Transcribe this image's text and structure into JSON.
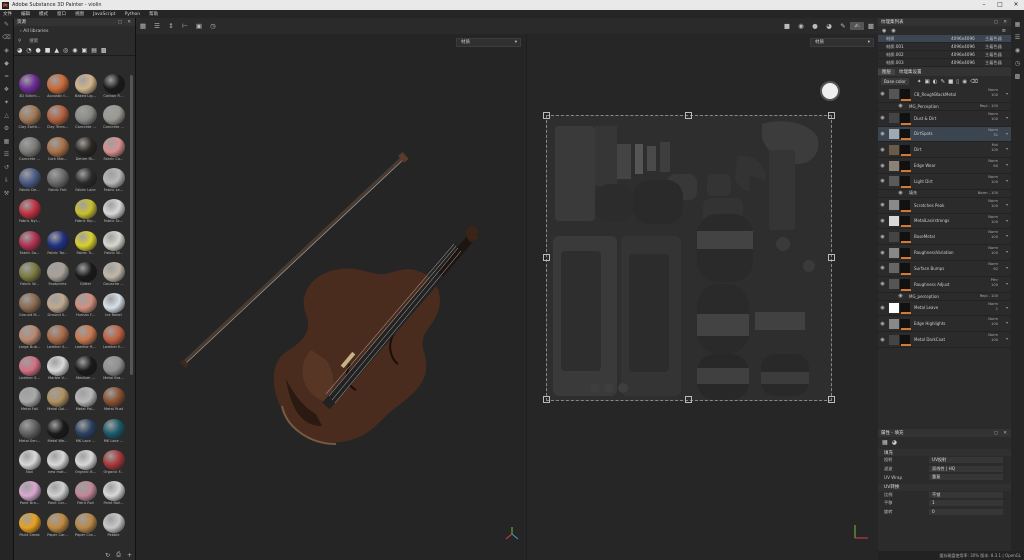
{
  "window": {
    "title": "Adobe Substance 3D Painter - violin",
    "app_icon": "Pt"
  },
  "menu": [
    "文件",
    "编辑",
    "模式",
    "窗口",
    "视图",
    "JavaScript",
    "Python",
    "帮助"
  ],
  "shelf": {
    "title": "资源",
    "library": "All libraries",
    "search_label": "搜索",
    "materials": [
      {
        "label": "3D Stitchi...",
        "color": "#6b2a94"
      },
      {
        "label": "Acoustic f...",
        "color": "#c86a3a"
      },
      {
        "label": "Baked Lig...",
        "color": "#d0b48a"
      },
      {
        "label": "Carbon Fi...",
        "color": "#1a1a1a"
      },
      {
        "label": "Clay Earth...",
        "color": "#a07856"
      },
      {
        "label": "Clay Terra...",
        "color": "#b2603e"
      },
      {
        "label": "Concrete ...",
        "color": "#8a8a86"
      },
      {
        "label": "Concrete ...",
        "color": "#9a9892"
      },
      {
        "label": "Concrete ...",
        "color": "#7a7a76"
      },
      {
        "label": "Cork Mat...",
        "color": "#a87048"
      },
      {
        "label": "Denim Ri...",
        "color": "#2a2622"
      },
      {
        "label": "Fabric Co...",
        "color": "#d89090"
      },
      {
        "label": "Fabric De...",
        "color": "#4a5a86"
      },
      {
        "label": "Fabric Felt",
        "color": "#6a6a6a"
      },
      {
        "label": "Fabric Lace",
        "color": "#2a2a2a"
      },
      {
        "label": "Fabric Le...",
        "color": "#b8b8b8"
      },
      {
        "label": "Fabric Nyl...",
        "color": "#c03040"
      },
      {
        "label": "",
        "color": "#2b2b2b"
      },
      {
        "label": "Fabric Rip...",
        "color": "#c8c030"
      },
      {
        "label": "Fabric Sc...",
        "color": "#d8d8d8"
      },
      {
        "label": "Fabric Sa...",
        "color": "#b03050"
      },
      {
        "label": "Fabric Tar...",
        "color": "#203080"
      },
      {
        "label": "Fabric Tr...",
        "color": "#d8d030"
      },
      {
        "label": "Fabric W...",
        "color": "#d8d8d0"
      },
      {
        "label": "Fabric W...",
        "color": "#7a7a40"
      },
      {
        "label": "Footprints",
        "color": "#a8a098"
      },
      {
        "label": "Glitter",
        "color": "#1a1a1a"
      },
      {
        "label": "Gouache ...",
        "color": "#c0b8a8"
      },
      {
        "label": "Ground M...",
        "color": "#8a6a50"
      },
      {
        "label": "Ground S...",
        "color": "#c0a890"
      },
      {
        "label": "Human F...",
        "color": "#d09080"
      },
      {
        "label": "Ice Rebel",
        "color": "#d8e0e8"
      },
      {
        "label": "Large Bub...",
        "color": "#b88870"
      },
      {
        "label": "Leather S...",
        "color": "#a86a48"
      },
      {
        "label": "Leather R...",
        "color": "#c87850"
      },
      {
        "label": "Leather E...",
        "color": "#c06040"
      },
      {
        "label": "Leather S...",
        "color": "#d07080"
      },
      {
        "label": "Marble V...",
        "color": "#d8d8d8"
      },
      {
        "label": "Medium ...",
        "color": "#1a1a1a"
      },
      {
        "label": "Metal Bra...",
        "color": "#909090"
      },
      {
        "label": "Metal Foil",
        "color": "#a8a8a8"
      },
      {
        "label": "Metal Gol...",
        "color": "#b09060"
      },
      {
        "label": "Metal Pol...",
        "color": "#b8b8b8"
      },
      {
        "label": "Metal Rust",
        "color": "#8a5030"
      },
      {
        "label": "Metal Sen...",
        "color": "#606060"
      },
      {
        "label": "Metal We...",
        "color": "#1a1a1a"
      },
      {
        "label": "MK Lace ...",
        "color": "#2a4060"
      },
      {
        "label": "MK Lace ...",
        "color": "#1a5a6a"
      },
      {
        "label": "Noil",
        "color": "#d8d8d8"
      },
      {
        "label": "new mat...",
        "color": "#d8d8d8"
      },
      {
        "label": "Organic B...",
        "color": "#d8d8d8"
      },
      {
        "label": "Organic F...",
        "color": "#a83838"
      },
      {
        "label": "Paint Bra...",
        "color": "#d8a8d0"
      },
      {
        "label": "Paint Car...",
        "color": "#d0d0d0"
      },
      {
        "label": "Paint Roll",
        "color": "#c08898"
      },
      {
        "label": "Paint Roll...",
        "color": "#d8d8d8"
      },
      {
        "label": "Paint Smea",
        "color": "#e8a020"
      },
      {
        "label": "Paper Car...",
        "color": "#c08a40"
      },
      {
        "label": "Paper Cra...",
        "color": "#b88848"
      },
      {
        "label": "Pebble",
        "color": "#c8c8c8"
      }
    ]
  },
  "viewport": {
    "left_dropdown": "材质",
    "right_dropdown": "材质"
  },
  "texture_sets": {
    "title": "纹理集列表",
    "rows": [
      {
        "name": "材质",
        "res": "4096x4096",
        "shader": "主着色器"
      },
      {
        "name": "材质.001",
        "res": "4096x4096",
        "shader": "主着色器"
      },
      {
        "name": "材质.002",
        "res": "4096x4096",
        "shader": "主着色器"
      },
      {
        "name": "材质.003",
        "res": "4096x4096",
        "shader": "主着色器"
      }
    ]
  },
  "layers": {
    "tabs": [
      "图层",
      "纹理集设置"
    ],
    "blend_mode": "Base color",
    "items": [
      {
        "name": "CB_RoughBlackMetal",
        "blend": "Norm",
        "opacity": "100",
        "thumb": "#555555",
        "type": "layer",
        "sel": false
      },
      {
        "name": "MG_Perception",
        "blend": "Repl",
        "opacity": "100",
        "thumb": "#444444",
        "type": "sub",
        "sel": false
      },
      {
        "name": "Dust & Dirt",
        "blend": "Norm",
        "opacity": "100",
        "thumb": "#444444",
        "type": "layer",
        "sel": false
      },
      {
        "name": "DirtSpots",
        "blend": "Norm",
        "opacity": "31",
        "thumb": "#a0a8b0",
        "type": "layer",
        "sel": true
      },
      {
        "name": "Dirt",
        "blend": "Mul",
        "opacity": "100",
        "thumb": "#6a5a48",
        "type": "layer",
        "sel": false
      },
      {
        "name": "Edge Wear",
        "blend": "Norm",
        "opacity": "60",
        "thumb": "#8a8278",
        "type": "layer",
        "sel": false
      },
      {
        "name": "Light Dirt",
        "blend": "Norm",
        "opacity": "100",
        "thumb": "#5a5a5a",
        "type": "layer",
        "sel": false
      },
      {
        "name": "填充",
        "blend": "Norm",
        "opacity": "100",
        "thumb": "#444444",
        "type": "sub",
        "sel": false
      },
      {
        "name": "Scratches Peak",
        "blend": "Norm",
        "opacity": "100",
        "thumb": "#8a8a8a",
        "type": "layer",
        "sel": false
      },
      {
        "name": "MetalLasirstrongs",
        "blend": "Norm",
        "opacity": "100",
        "thumb": "#d8d8d8",
        "type": "layer",
        "sel": false
      },
      {
        "name": "BaseMetal",
        "blend": "Norm",
        "opacity": "100",
        "thumb": "#444444",
        "type": "layer",
        "sel": false
      },
      {
        "name": "RoughnessVariation",
        "blend": "Norm",
        "opacity": "100",
        "thumb": "#888888",
        "type": "layer",
        "sel": false
      },
      {
        "name": "Surface Bumps",
        "blend": "Norm",
        "opacity": "62",
        "thumb": "#666666",
        "type": "layer",
        "sel": false
      },
      {
        "name": "Roughness Adjust",
        "blend": "Pthr",
        "opacity": "100",
        "thumb": "#555555",
        "type": "layer",
        "sel": false
      },
      {
        "name": "MG_perception",
        "blend": "Repl",
        "opacity": "100",
        "thumb": "#444444",
        "type": "sub",
        "sel": false
      },
      {
        "name": "Metal Leave",
        "blend": "Norm",
        "opacity": "1",
        "thumb": "#ffffff",
        "type": "layer",
        "sel": false
      },
      {
        "name": "Edge Highlights",
        "blend": "Norm",
        "opacity": "100",
        "thumb": "#888888",
        "type": "layer",
        "sel": false
      },
      {
        "name": "Metal DarkCoat",
        "blend": "Norm",
        "opacity": "100",
        "thumb": "#444444",
        "type": "layer",
        "sel": false
      }
    ]
  },
  "properties": {
    "title": "属性 - 填充",
    "section": "填充",
    "rows": [
      {
        "label": "投射",
        "value": "UV投射"
      },
      {
        "label": "滤波",
        "value": "双线性 | HQ"
      },
      {
        "label": "UV Wrap",
        "value": "重复"
      }
    ],
    "uv_section": "UV转换",
    "uv_rows": [
      {
        "label": "比例",
        "value": "不锁"
      },
      {
        "label": "平移",
        "value": "1"
      },
      {
        "label": "旋转",
        "value": "0"
      }
    ]
  },
  "status": {
    "text": "缓存磁盘使用率: 30%  版本: 8.3.1 | OpenGL"
  }
}
